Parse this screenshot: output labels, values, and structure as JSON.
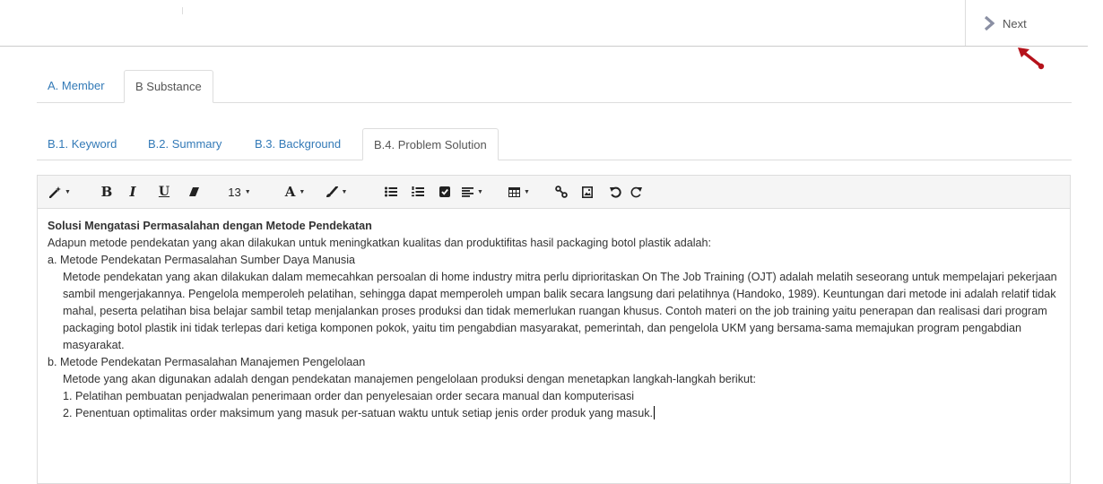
{
  "header": {
    "next_label": "Next"
  },
  "tabs_main": [
    {
      "label": "A. Member",
      "active": false
    },
    {
      "label": "B Substance",
      "active": true
    }
  ],
  "tabs_sub": [
    {
      "label": "B.1. Keyword",
      "active": false
    },
    {
      "label": "B.2. Summary",
      "active": false
    },
    {
      "label": "B.3. Background",
      "active": false
    },
    {
      "label": "B.4. Problem Solution",
      "active": true
    }
  ],
  "toolbar": {
    "font_size": "13",
    "bold": "B",
    "italic": "I",
    "underline": "U",
    "font_color": "A"
  },
  "content": {
    "title": "Solusi  Mengatasi Permasalahan dengan Metode Pendekatan",
    "intro": "Adapun metode pendekatan yang akan dilakukan untuk meningkatkan kualitas dan produktifitas hasil packaging botol plastik adalah:",
    "section_a": "a. Metode Pendekatan Permasalahan Sumber Daya Manusia",
    "para_a": "Metode pendekatan yang akan dilakukan dalam memecahkan persoalan di home industry mitra perlu diprioritaskan On The Job Training (OJT) adalah melatih seseorang untuk mempelajari pekerjaan sambil mengerjakannya. Pengelola memperoleh pelatihan, sehingga dapat memperoleh umpan balik secara langsung dari pelatihnya (Handoko, 1989). Keuntungan dari metode ini adalah relatif tidak mahal, peserta pelatihan bisa belajar sambil tetap menjalankan proses produksi dan tidak memerlukan ruangan khusus. Contoh materi on the job training yaitu penerapan dan realisasi dari program packaging botol plastik ini tidak terlepas dari ketiga komponen pokok, yaitu tim pengabdian masyarakat, pemerintah, dan pengelola UKM yang bersama-sama memajukan program pengabdian masyarakat.",
    "section_b": "b. Metode Pendekatan Permasalahan Manajemen Pengelolaan",
    "para_b": "Metode yang akan digunakan adalah dengan pendekatan manajemen pengelolaan produksi dengan menetapkan langkah-langkah berikut:",
    "item_1": "1. Pelatihan pembuatan penjadwalan penerimaan order dan penyelesaian order secara manual dan komputerisasi",
    "item_2": "2. Penentuan optimalitas order maksimum yang masuk per-satuan waktu untuk setiap jenis order produk yang masuk."
  },
  "colors": {
    "link": "#337ab7",
    "pointer_arrow": "#b5121b",
    "next_chevron": "#8a8fa3"
  }
}
